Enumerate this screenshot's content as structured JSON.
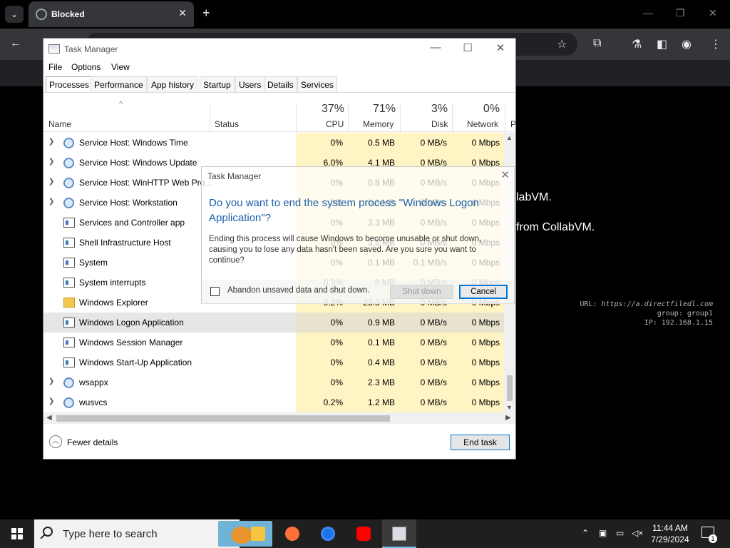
{
  "browser": {
    "tab_title": "Blocked",
    "tab_close": "✕",
    "new_tab": "+",
    "tab_search_icon": "chevron-down",
    "window_controls": {
      "minimize": "—",
      "restore": "❐",
      "close": "✕"
    },
    "toolbar_icons": [
      "back-arrow",
      "star",
      "extensions",
      "labs-flask",
      "side-panel",
      "profile",
      "menu-dots"
    ],
    "background_lines": [
      "labVM.",
      "from CollabVM."
    ],
    "vm_info": {
      "url_label": "URL: ",
      "url_value": "https://a.directfiledl.com",
      "group": "group: group1",
      "ip": "IP: 192.168.1.15"
    }
  },
  "task_manager": {
    "title": "Task Manager",
    "window_controls": {
      "minimize": "—",
      "maximize": "☐",
      "close": "✕"
    },
    "menu": [
      "File",
      "Options",
      "View"
    ],
    "tabs": [
      "Processes",
      "Performance",
      "App history",
      "Startup",
      "Users",
      "Details",
      "Services"
    ],
    "active_tab": "Processes",
    "columns": {
      "name": "Name",
      "status": "Status",
      "cpu": {
        "pct": "37%",
        "label": "CPU"
      },
      "memory": {
        "pct": "71%",
        "label": "Memory"
      },
      "disk": {
        "pct": "3%",
        "label": "Disk"
      },
      "network": {
        "pct": "0%",
        "label": "Network"
      },
      "extra": "P"
    },
    "sort_indicator": "^",
    "processes": [
      {
        "name": "Service Host: Windows Time",
        "icon": "gear",
        "expandable": true,
        "cpu": "0%",
        "memory": "0.5 MB",
        "disk": "0 MB/s",
        "network": "0 Mbps"
      },
      {
        "name": "Service Host: Windows Update",
        "icon": "gear",
        "expandable": true,
        "cpu": "6.0%",
        "memory": "4.1 MB",
        "disk": "0 MB/s",
        "network": "0 Mbps"
      },
      {
        "name": "Service Host: WinHTTP Web Pro...",
        "icon": "gear",
        "expandable": true,
        "cpu": "0%",
        "memory": "0.8 MB",
        "disk": "0 MB/s",
        "network": "0 Mbps"
      },
      {
        "name": "Service Host: Workstation",
        "icon": "gear",
        "expandable": true,
        "cpu": "0%",
        "memory": "0.3 MB",
        "disk": "0 MB/s",
        "network": "0 Mbps"
      },
      {
        "name": "Services and Controller app",
        "icon": "app",
        "expandable": false,
        "cpu": "0%",
        "memory": "3.3 MB",
        "disk": "0 MB/s",
        "network": "0 Mbps"
      },
      {
        "name": "Shell Infrastructure Host",
        "icon": "app",
        "expandable": false,
        "cpu": "0%",
        "memory": "3.5 MB",
        "disk": "0 MB/s",
        "network": "0 Mbps"
      },
      {
        "name": "System",
        "icon": "app",
        "expandable": false,
        "cpu": "0%",
        "memory": "0.1 MB",
        "disk": "0.1 MB/s",
        "network": "0 Mbps"
      },
      {
        "name": "System interrupts",
        "icon": "app",
        "expandable": false,
        "cpu": "0.3%",
        "memory": "0 MB",
        "disk": "0 MB/s",
        "network": "0 Mbps"
      },
      {
        "name": "Windows Explorer",
        "icon": "folder",
        "expandable": false,
        "cpu": "0.2%",
        "memory": "23.3 MB",
        "disk": "0 MB/s",
        "network": "0 Mbps"
      },
      {
        "name": "Windows Logon Application",
        "icon": "app",
        "expandable": false,
        "selected": true,
        "cpu": "0%",
        "memory": "0.9 MB",
        "disk": "0 MB/s",
        "network": "0 Mbps"
      },
      {
        "name": "Windows Session Manager",
        "icon": "app",
        "expandable": false,
        "cpu": "0%",
        "memory": "0.1 MB",
        "disk": "0 MB/s",
        "network": "0 Mbps"
      },
      {
        "name": "Windows Start-Up Application",
        "icon": "app",
        "expandable": false,
        "cpu": "0%",
        "memory": "0.4 MB",
        "disk": "0 MB/s",
        "network": "0 Mbps"
      },
      {
        "name": "wsappx",
        "icon": "gear",
        "expandable": true,
        "cpu": "0%",
        "memory": "2.3 MB",
        "disk": "0 MB/s",
        "network": "0 Mbps"
      },
      {
        "name": "wusvcs",
        "icon": "gear",
        "expandable": true,
        "cpu": "0.2%",
        "memory": "1.2 MB",
        "disk": "0 MB/s",
        "network": "0 Mbps"
      }
    ],
    "fewer_details": "Fewer details",
    "end_task": "End task"
  },
  "dialog": {
    "title": "Task Manager",
    "close": "✕",
    "question": "Do you want to end the system process \"Windows Logon Application\"?",
    "body": "Ending this process will cause Windows to become unusable or shut down, causing you to lose any data hasn't been saved. Are you sure you want to continue?",
    "checkbox_label": "Abandon unsaved data and shut down.",
    "shutdown_button": "Shut down",
    "cancel_button": "Cancel"
  },
  "taskbar": {
    "search_placeholder": "Type here to search",
    "pinned_apps": [
      "file-explorer",
      "firefox",
      "chrome",
      "youtube",
      "task-manager"
    ],
    "active_app": "task-manager",
    "time": "11:44 AM",
    "date": "7/29/2024",
    "notification_count": "1"
  }
}
